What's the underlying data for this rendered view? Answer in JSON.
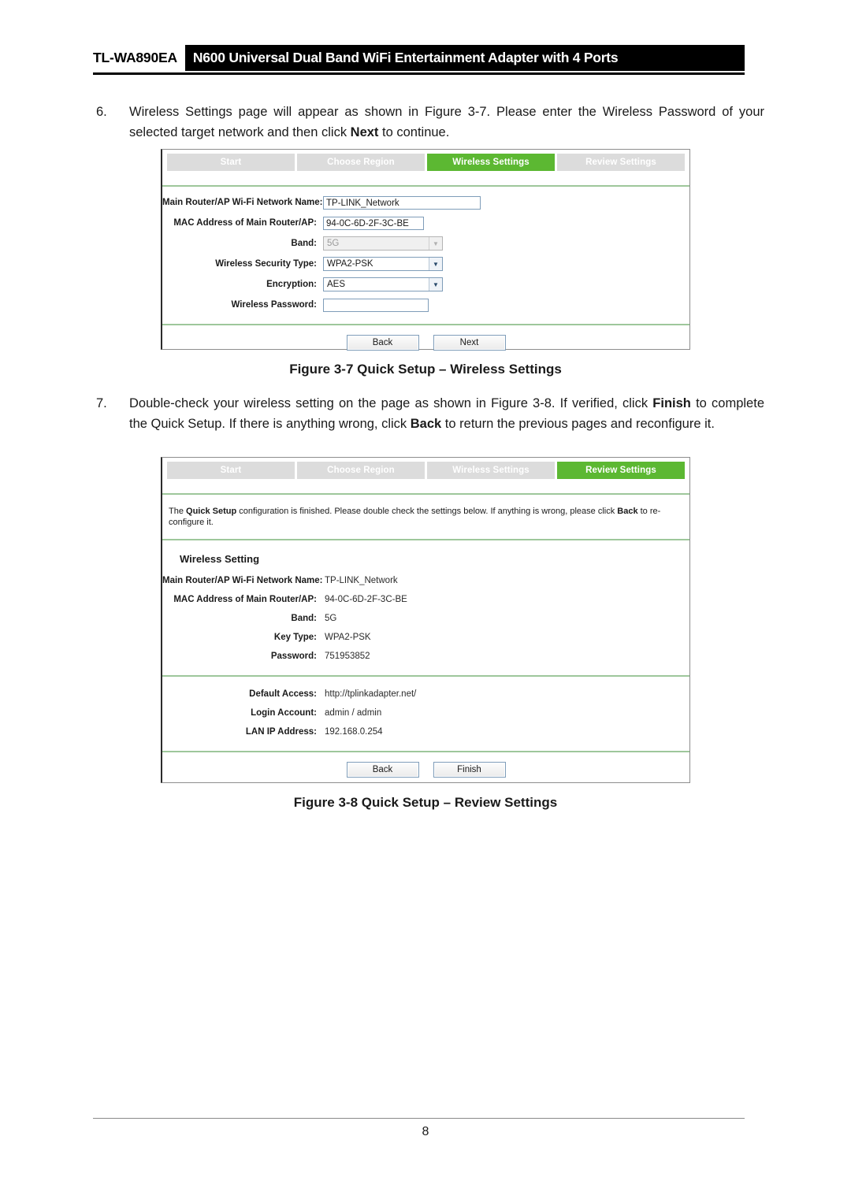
{
  "header": {
    "model": "TL-WA890EA",
    "title": "N600 Universal Dual Band WiFi Entertainment Adapter with 4 Ports"
  },
  "steps": [
    {
      "number": "6.",
      "text_parts": [
        {
          "t": "Wireless Settings page will appear as shown in Figure 3-7. Please enter the Wireless Password of your selected target network and then click ",
          "bold": false
        },
        {
          "t": "Next",
          "bold": true
        },
        {
          "t": " to continue.",
          "bold": false
        }
      ]
    },
    {
      "number": "7.",
      "text_parts": [
        {
          "t": "Double-check your wireless setting on the page as shown in Figure 3-8. If verified, click ",
          "bold": false
        },
        {
          "t": "Finish",
          "bold": true
        },
        {
          "t": " to complete the Quick Setup. If there is anything wrong, click ",
          "bold": false
        },
        {
          "t": "Back",
          "bold": true
        },
        {
          "t": " to return the previous pages and reconfigure it.",
          "bold": false
        }
      ]
    }
  ],
  "figure1": {
    "tabs": [
      {
        "label": "Start",
        "active": false
      },
      {
        "label": "Choose Region",
        "active": false
      },
      {
        "label": "Wireless Settings",
        "active": true
      },
      {
        "label": "Review Settings",
        "active": false
      }
    ],
    "fields": [
      {
        "label": "Main Router/AP Wi-Fi Network Name:",
        "value": "TP-LINK_Network",
        "type": "text",
        "width": "w-ssid",
        "disabled": false
      },
      {
        "label": "MAC Address of Main Router/AP:",
        "value": "94-0C-6D-2F-3C-BE",
        "type": "text",
        "width": "w-mac",
        "disabled": false
      },
      {
        "label": "Band:",
        "value": "5G",
        "type": "select",
        "disabled": true
      },
      {
        "label": "Wireless Security Type:",
        "value": "WPA2-PSK",
        "type": "select",
        "disabled": false
      },
      {
        "label": "Encryption:",
        "value": "AES",
        "type": "select",
        "disabled": false
      },
      {
        "label": "Wireless Password:",
        "value": "",
        "type": "text",
        "width": "w-pass",
        "disabled": false
      }
    ],
    "buttons": {
      "back": "Back",
      "next": "Next"
    }
  },
  "caption1": "Figure 3-7 Quick Setup – Wireless Settings",
  "figure2": {
    "tabs": [
      {
        "label": "Start",
        "active": false
      },
      {
        "label": "Choose Region",
        "active": false
      },
      {
        "label": "Wireless Settings",
        "active": false
      },
      {
        "label": "Review Settings",
        "active": true
      }
    ],
    "notice_parts": [
      {
        "t": "The ",
        "bold": false
      },
      {
        "t": "Quick Setup",
        "bold": true
      },
      {
        "t": " configuration is finished. Please double check the settings below. If anything is wrong, please click ",
        "bold": false
      },
      {
        "t": "Back",
        "bold": true
      },
      {
        "t": " to re-configure it.",
        "bold": false
      }
    ],
    "section_title": "Wireless Setting",
    "rows_group1": [
      {
        "label": "Main Router/AP Wi-Fi Network Name:",
        "value": "TP-LINK_Network"
      },
      {
        "label": "MAC Address of Main Router/AP:",
        "value": "94-0C-6D-2F-3C-BE"
      },
      {
        "label": "Band:",
        "value": "5G"
      },
      {
        "label": "Key Type:",
        "value": "WPA2-PSK"
      },
      {
        "label": "Password:",
        "value": "751953852"
      }
    ],
    "rows_group2": [
      {
        "label": "Default Access:",
        "value": "http://tplinkadapter.net/"
      },
      {
        "label": "Login Account:",
        "value": "admin / admin"
      },
      {
        "label": "LAN IP Address:",
        "value": "192.168.0.254"
      }
    ],
    "buttons": {
      "back": "Back",
      "finish": "Finish"
    }
  },
  "caption2": "Figure 3-8 Quick Setup – Review Settings",
  "footer": {
    "page_number": "8"
  },
  "colors": {
    "accent_green": "#5cb832",
    "divider_green": "#9ec79b",
    "tab_inactive": "#dcdcdc",
    "header_black": "#000000"
  }
}
